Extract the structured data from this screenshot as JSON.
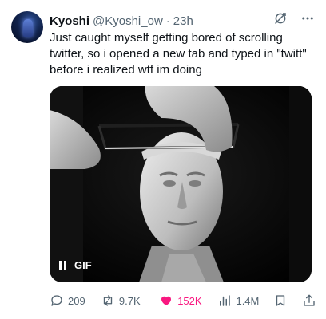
{
  "author": {
    "name": "Kyoshi",
    "handle": "@Kyoshi_ow",
    "separator": "·",
    "time": "23h"
  },
  "tweet": {
    "text": "Just caught myself getting bored of scrolling twitter, so i opened a new tab and typed in \"twitt\" before i realized wtf im doing"
  },
  "media": {
    "badge": "GIF",
    "state": "playing"
  },
  "actions": {
    "replies": "209",
    "reposts": "9.7K",
    "likes": "152K",
    "views": "1.4M"
  },
  "icons": {
    "top": [
      "grok-icon",
      "more-icon"
    ],
    "actions": [
      "reply-icon",
      "repost-icon",
      "like-icon",
      "views-icon",
      "bookmark-icon",
      "share-icon"
    ]
  },
  "colors": {
    "text": "#0f1419",
    "muted": "#536471",
    "like": "#f91880"
  }
}
